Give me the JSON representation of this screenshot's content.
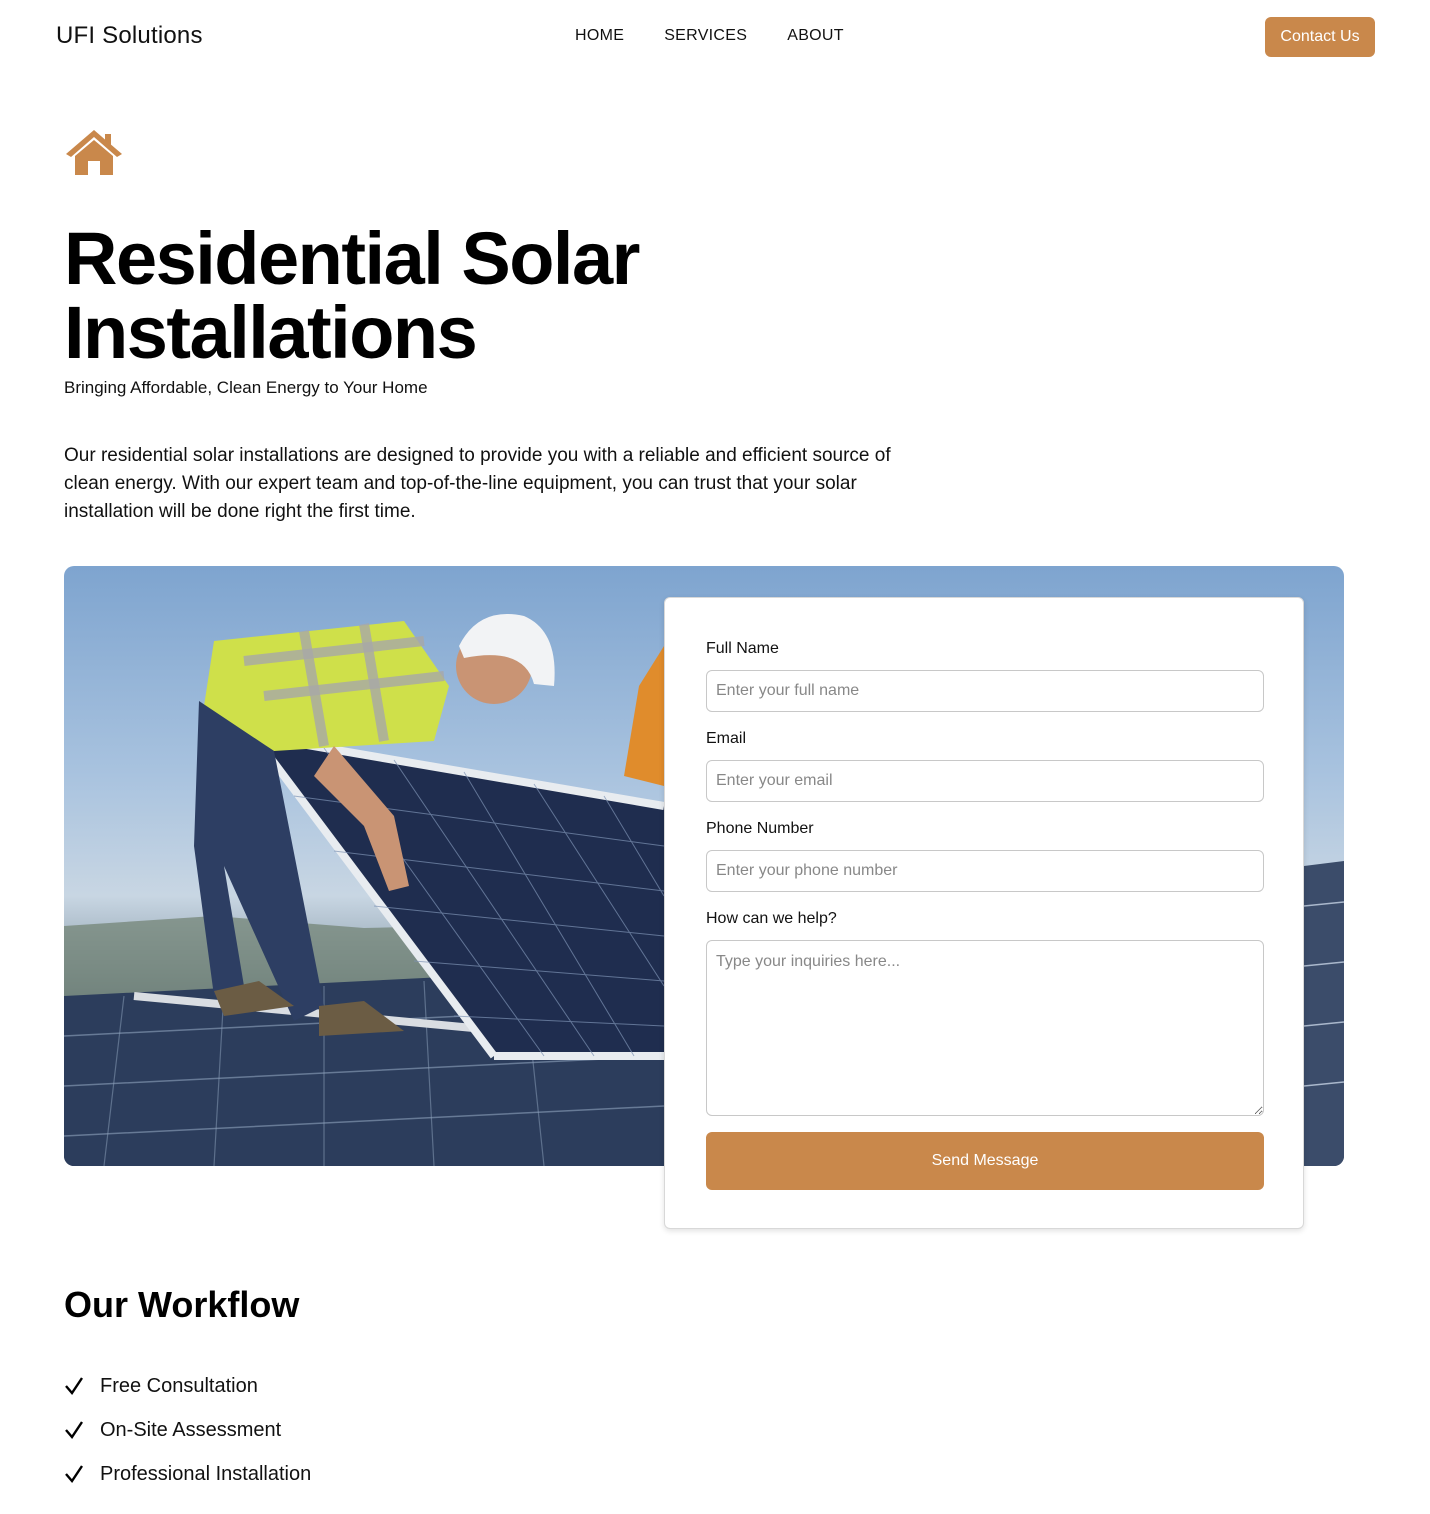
{
  "header": {
    "logo": "UFI Solutions",
    "nav": [
      "HOME",
      "SERVICES",
      "ABOUT"
    ],
    "contact_label": "Contact Us"
  },
  "hero": {
    "icon": "home-icon",
    "title": "Residential Solar Installations",
    "subtitle": "Bringing Affordable, Clean Energy to Your Home",
    "description": "Our residential solar installations are designed to provide you with a reliable and efficient source of clean energy. With our expert team and top-of-the-line equipment, you can trust that your solar installation will be done right the first time."
  },
  "form": {
    "name_label": "Full Name",
    "name_placeholder": "Enter your full name",
    "email_label": "Email",
    "email_placeholder": "Enter your email",
    "phone_label": "Phone Number",
    "phone_placeholder": "Enter your phone number",
    "help_label": "How can we help?",
    "help_placeholder": "Type your inquiries here...",
    "submit_label": "Send Message"
  },
  "workflow": {
    "title": "Our Workflow",
    "items": [
      "Free Consultation",
      "On-Site Assessment",
      "Professional Installation"
    ]
  },
  "colors": {
    "accent": "#c9884b"
  }
}
